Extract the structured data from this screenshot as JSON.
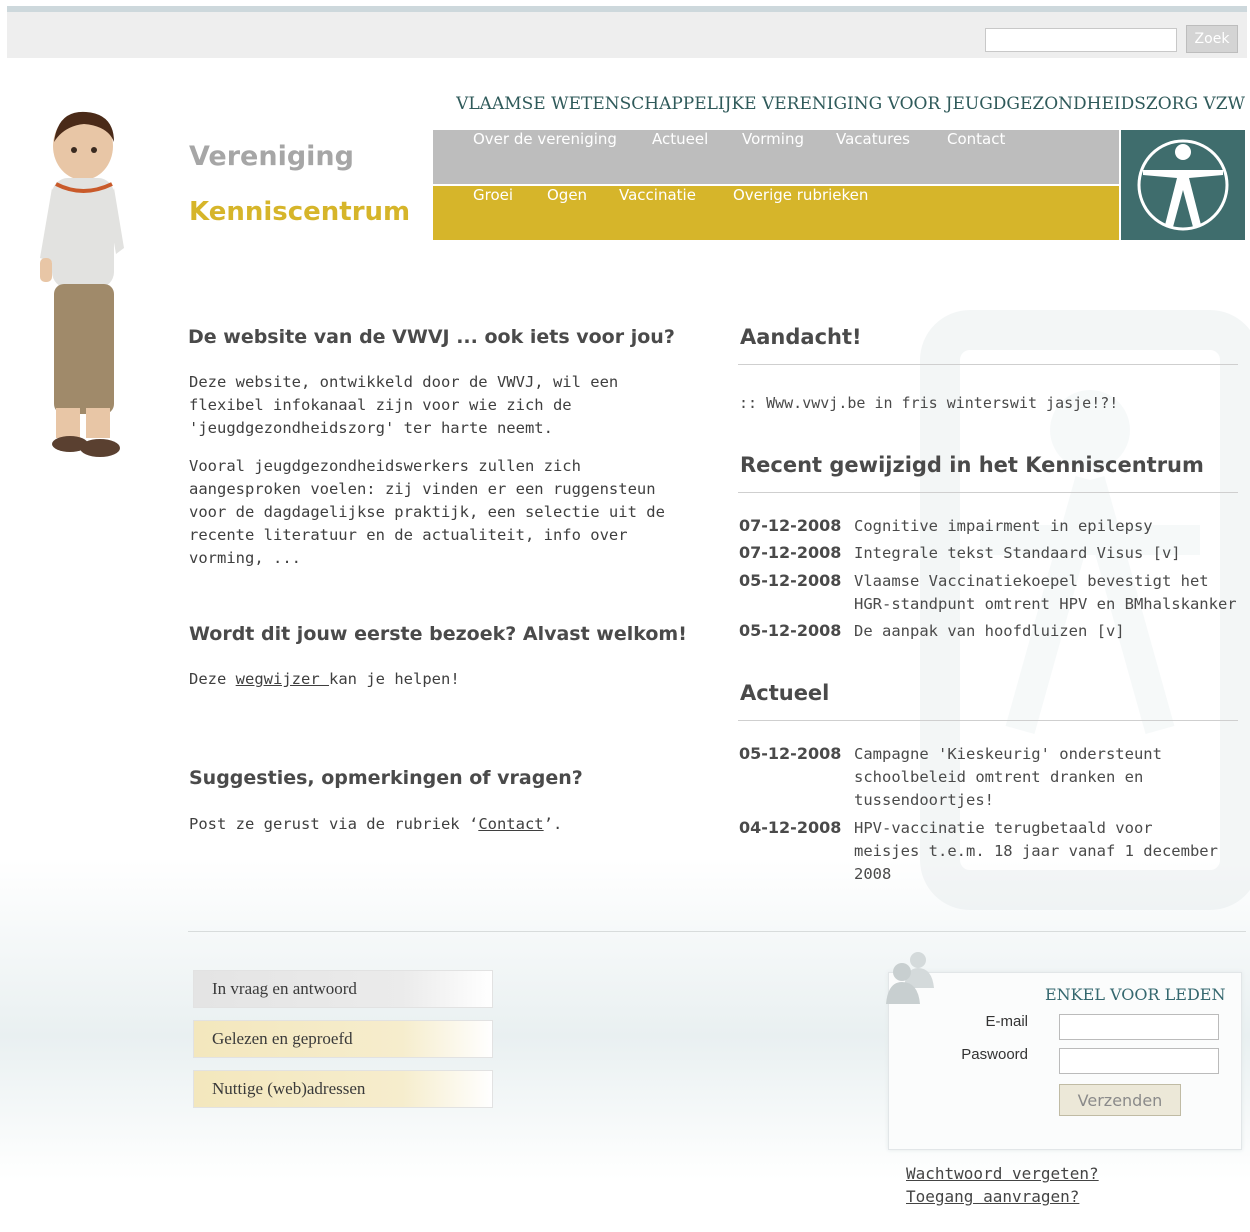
{
  "search": {
    "placeholder": "",
    "button_label": "Zoek"
  },
  "header": {
    "org_name": "VLAAMSE WETENSCHAPPELIJKE VERENIGING VOOR JEUGDGEZONDHEIDSZORG VZW",
    "section_vereniging": "Vereniging",
    "section_kenniscentrum": "Kenniscentrum"
  },
  "nav": {
    "vereniging_items": [
      "Over de vereniging",
      "Actueel",
      "Vorming",
      "Vacatures",
      "Contact"
    ],
    "kenniscentrum_items": [
      "Groei",
      "Ogen",
      "Vaccinatie",
      "Overige rubrieken"
    ]
  },
  "intro": {
    "heading": "De website van de VWVJ ... ook iets voor jou?",
    "paragraph1": "Deze website, ontwikkeld door de VWVJ, wil een flexibel infokanaal zijn voor wie zich de 'jeugdgezondheidszorg' ter harte neemt.",
    "paragraph2": "Vooral jeugdgezondheidswerkers zullen zich aangesproken voelen: zij vinden er een ruggensteun voor de dagdagelijkse praktijk, een selectie uit de recente literatuur en de actualiteit, info over vorming, ..."
  },
  "welcome": {
    "heading": "Wordt dit jouw eerste bezoek? Alvast welkom!",
    "text_before": "Deze ",
    "link": "wegwijzer ",
    "text_after": "kan je helpen!"
  },
  "suggestions": {
    "heading": "Suggesties, opmerkingen of vragen?",
    "text_before": "Post ze gerust via de rubriek ",
    "quote_open": "‘",
    "link": "Contact",
    "quote_close": "’."
  },
  "attention": {
    "heading": "Aandacht!",
    "items": [
      ":: Www.vwvj.be in fris winterswit jasje!?!"
    ]
  },
  "recent": {
    "heading": "Recent gewijzigd in het Kenniscentrum",
    "items": [
      {
        "date": "07-12-2008",
        "title": "Cognitive impairment in epilepsy"
      },
      {
        "date": "07-12-2008",
        "title": "Integrale tekst Standaard Visus [v]"
      },
      {
        "date": "05-12-2008",
        "title": "Vlaamse Vaccinatiekoepel bevestigt het HGR-standpunt omtrent HPV en BMhalskanker"
      },
      {
        "date": "05-12-2008",
        "title": "De aanpak van hoofdluizen [v]"
      }
    ]
  },
  "actueel": {
    "heading": "Actueel",
    "items": [
      {
        "date": "05-12-2008",
        "title": "Campagne 'Kieskeurig' ondersteunt schoolbeleid omtrent dranken en tussendoortjes!"
      },
      {
        "date": "04-12-2008",
        "title": "HPV-vaccinatie terugbetaald voor meisjes t.e.m. 18 jaar vanaf 1 december 2008"
      }
    ]
  },
  "side_buttons": [
    "In vraag en antwoord",
    "Gelezen en geproefd",
    "Nuttige (web)adressen"
  ],
  "login": {
    "title": "ENKEL VOOR LEDEN",
    "email_label": "E-mail",
    "password_label": "Paswoord",
    "submit_label": "Verzenden",
    "forgot_link": "Wachtwoord vergeten?",
    "request_link": "Toegang aanvragen?"
  },
  "colors": {
    "accent_yellow": "#d6b52a",
    "nav_grey": "#bdbdbd",
    "teal": "#3f6d6d"
  }
}
